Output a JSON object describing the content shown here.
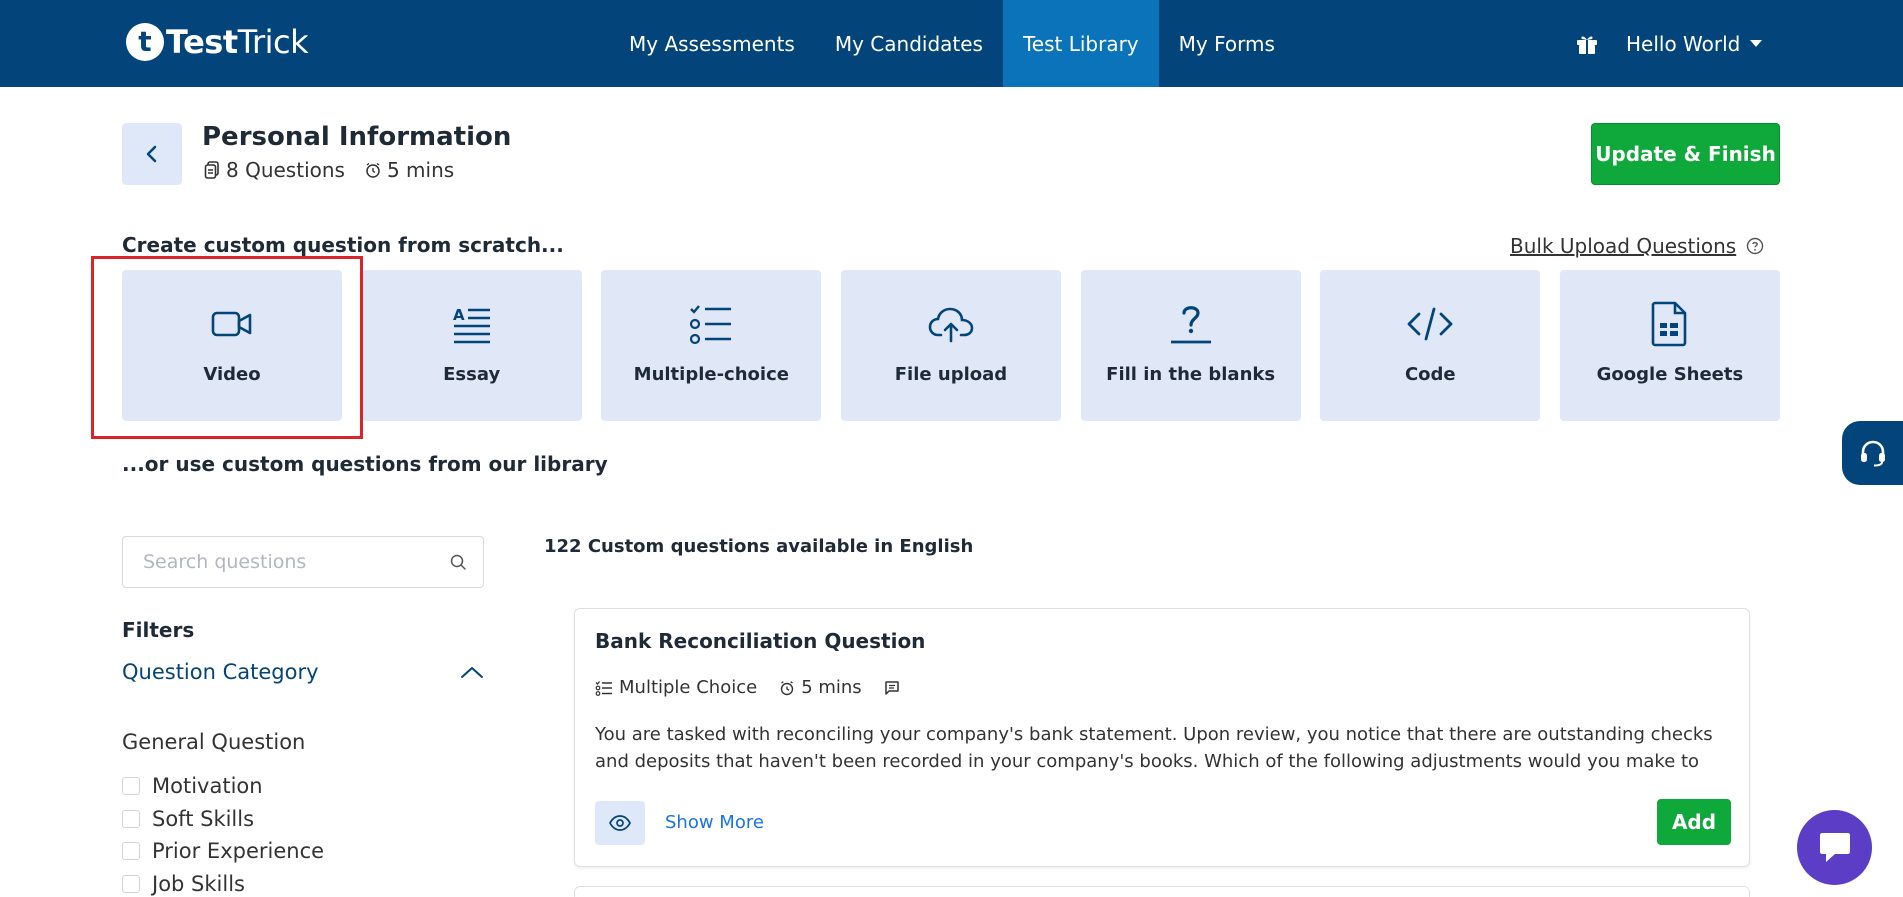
{
  "brand": {
    "logo_letter": "t",
    "name_bold": "Test",
    "name_regular": "Trick"
  },
  "nav": {
    "links": [
      {
        "label": "My Assessments",
        "active": false
      },
      {
        "label": "My Candidates",
        "active": false
      },
      {
        "label": "Test Library",
        "active": true
      },
      {
        "label": "My Forms",
        "active": false
      }
    ],
    "user_label": "Hello World"
  },
  "header": {
    "title": "Personal Information",
    "questions_count": "8 Questions",
    "duration": "5 mins",
    "finish_label": "Update & Finish"
  },
  "create": {
    "title": "Create custom question from scratch...",
    "bulk_label": "Bulk Upload Questions",
    "types": [
      {
        "label": "Video",
        "icon": "video-icon"
      },
      {
        "label": "Essay",
        "icon": "essay-icon"
      },
      {
        "label": "Multiple-choice",
        "icon": "checklist-icon"
      },
      {
        "label": "File upload",
        "icon": "cloud-upload-icon"
      },
      {
        "label": "Fill in the blanks",
        "icon": "question-mark-icon"
      },
      {
        "label": "Code",
        "icon": "code-icon"
      },
      {
        "label": "Google Sheets",
        "icon": "spreadsheet-icon"
      }
    ]
  },
  "library": {
    "title": "...or use custom questions from our library",
    "count_text": "122 Custom questions available in English"
  },
  "sidebar": {
    "search_placeholder": "Search questions",
    "filters_title": "Filters",
    "category_title": "Question Category",
    "group_title": "General Question",
    "options": [
      "Motivation",
      "Soft Skills",
      "Prior Experience",
      "Job Skills"
    ]
  },
  "question": {
    "title": "Bank Reconciliation Question",
    "type": "Multiple Choice",
    "duration": "5 mins",
    "description": "You are tasked with reconciling your company's bank statement. Upon review, you notice that there are outstanding checks and deposits that haven't been recorded in your company's books. Which of the following adjustments would you make to reconcile",
    "show_more": "Show More",
    "add_label": "Add"
  },
  "colors": {
    "navy": "#03457a",
    "active_nav": "#0b73b9",
    "green": "#0fa83a",
    "tile_bg": "#e0e8f8",
    "highlight": "#d9252a",
    "chat": "#5b3dc6"
  }
}
